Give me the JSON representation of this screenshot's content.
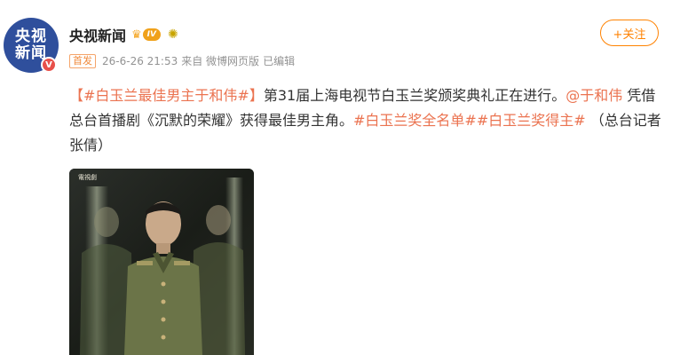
{
  "account": {
    "avatar_line1": "央视",
    "avatar_line2": "新闻",
    "verified_mark": "V",
    "name": "央视新闻",
    "level_label": "IV",
    "follow_label": "+关注"
  },
  "meta": {
    "first_tag": "首发",
    "timestamp": "26-6-26 21:53",
    "source": "来自 微博网页版",
    "edited": "已编辑"
  },
  "post": {
    "hashtag_title": "【#白玉兰最佳男主于和伟#】",
    "text1": "第31届上海电视节白玉兰奖颁奖典礼正在进行。",
    "mention": "@于和伟",
    "text2": " 凭借总台首播剧《沉默的荣耀》获得最佳男主角。",
    "hashtag2": "#白玉兰奖全名单#",
    "hashtag3": "#白玉兰奖得主#",
    "text3": " （总台记者张倩）"
  },
  "image": {
    "corner_mark": "電視劇"
  },
  "colors": {
    "accent": "#ff8200",
    "hashtag": "#eb7350",
    "avatar_bg": "#2f4f9c"
  },
  "icons": {
    "crown": "crown-icon",
    "sun": "sun-icon",
    "verified": "verified-v-icon"
  }
}
